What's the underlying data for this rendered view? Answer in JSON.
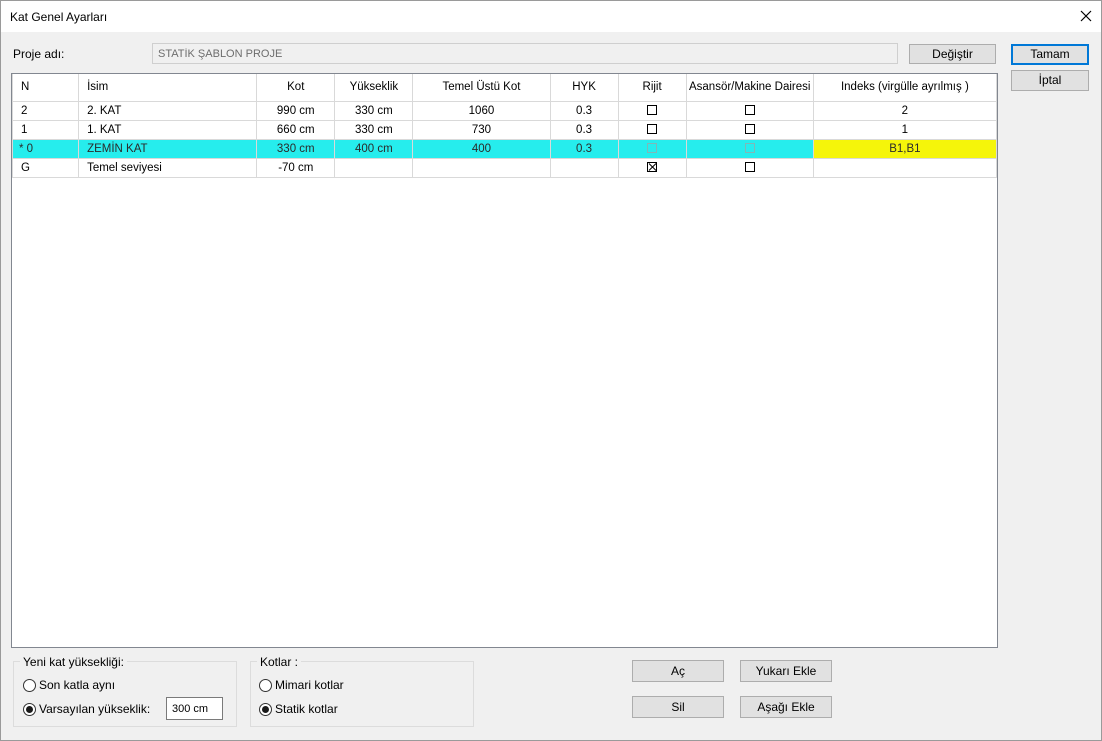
{
  "window": {
    "title": "Kat Genel Ayarları"
  },
  "project": {
    "label": "Proje adı:",
    "value": "STATİK ŞABLON PROJE",
    "change_button": "Değiştir"
  },
  "dialog_buttons": {
    "ok": "Tamam",
    "cancel": "İptal"
  },
  "table": {
    "headers": [
      "N",
      "İsim",
      "Kot",
      "Yükseklik",
      "Temel Üstü Kot",
      "HYK",
      "Rijit",
      "Asansör/Makine Dairesi",
      "Indeks (virgülle ayrılmış )"
    ],
    "rows": [
      {
        "n": "2",
        "name": "2. KAT",
        "kot": "990 cm",
        "height": "330 cm",
        "foundation_top": "1060",
        "hyk": "0.3",
        "rigid": false,
        "elevator": false,
        "index": "2"
      },
      {
        "n": "1",
        "name": "1. KAT",
        "kot": "660 cm",
        "height": "330 cm",
        "foundation_top": "730",
        "hyk": "0.3",
        "rigid": false,
        "elevator": false,
        "index": "1"
      },
      {
        "n": "* 0",
        "name": "ZEMİN KAT",
        "kot": "330 cm",
        "height": "400 cm",
        "foundation_top": "400",
        "hyk": "0.3",
        "rigid": false,
        "elevator": false,
        "index": "B1,B1"
      },
      {
        "n": "G",
        "name": "Temel seviyesi",
        "kot": "-70 cm",
        "height": "",
        "foundation_top": "",
        "hyk": "",
        "rigid": true,
        "elevator": false,
        "index": ""
      }
    ]
  },
  "new_floor_height": {
    "title": "Yeni kat yüksekliği:",
    "option_same": "Son katla aynı",
    "option_default": "Varsayılan yükseklik:",
    "default_value": "300 cm",
    "selected": "default"
  },
  "levels": {
    "title": "Kotlar :",
    "option_arch": "Mimari kotlar",
    "option_static": "Statik kotlar",
    "selected": "static"
  },
  "actions": {
    "open": "Aç",
    "insert_above": "Yukarı Ekle",
    "delete": "Sil",
    "insert_below": "Aşağı Ekle"
  },
  "colors": {
    "selected_row": "#26eded",
    "edit_cell": "#f5f50a",
    "underline": "#e8161e",
    "focus_border": "#0078d7"
  }
}
